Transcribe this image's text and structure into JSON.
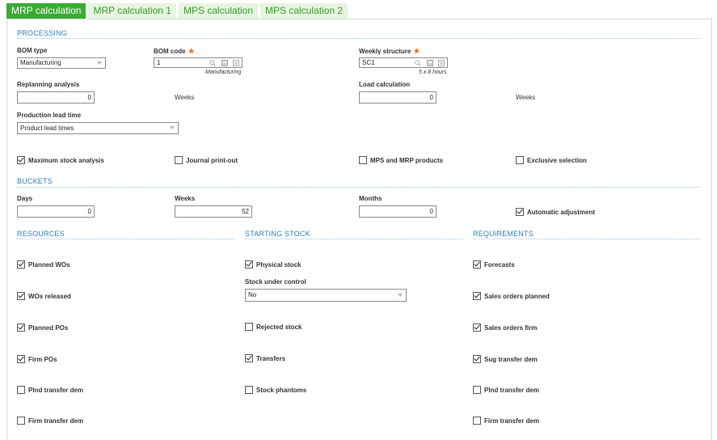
{
  "tabs": [
    "MRP calculation",
    "MRP calculation 1",
    "MPS calculation",
    "MPS calculation 2"
  ],
  "processing": {
    "title": "PROCESSING",
    "bom_type": {
      "label": "BOM type",
      "value": "Manufacturing"
    },
    "bom_code": {
      "label": "BOM code",
      "value": "1",
      "hint": "Manufacturing"
    },
    "weekly_structure": {
      "label": "Weekly structure",
      "value": "SC1",
      "hint": "5 x 8 hours"
    },
    "replanning": {
      "label": "Replanning analysis",
      "value": "0",
      "unit": "Weeks"
    },
    "load_calc": {
      "label": "Load calculation",
      "value": "0",
      "unit": "Weeks"
    },
    "prod_lead": {
      "label": "Production lead time",
      "value": "Product lead times"
    },
    "checks": [
      {
        "label": "Maximum stock analysis",
        "checked": true
      },
      {
        "label": "Journal print-out",
        "checked": false
      },
      {
        "label": "MPS and MRP products",
        "checked": false
      },
      {
        "label": "Exclusive selection",
        "checked": false
      }
    ]
  },
  "buckets": {
    "title": "BUCKETS",
    "days": {
      "label": "Days",
      "value": "0"
    },
    "weeks": {
      "label": "Weeks",
      "value": "52"
    },
    "months": {
      "label": "Months",
      "value": "0"
    },
    "auto": {
      "label": "Automatic adjustment",
      "checked": true
    }
  },
  "resources": {
    "title": "RESOURCES",
    "items": [
      {
        "label": "Planned WOs",
        "checked": true
      },
      {
        "label": "WOs released",
        "checked": true
      },
      {
        "label": "Planned POs",
        "checked": true
      },
      {
        "label": "Firm POs",
        "checked": true
      },
      {
        "label": "Plnd transfer dem",
        "checked": false
      },
      {
        "label": "Firm transfer dem",
        "checked": false
      }
    ]
  },
  "starting_stock": {
    "title": "STARTING STOCK",
    "physical": {
      "label": "Physical stock",
      "checked": true
    },
    "under_control": {
      "label": "Stock under control",
      "value": "No"
    },
    "rejected": {
      "label": "Rejected stock",
      "checked": false
    },
    "transfers": {
      "label": "Transfers",
      "checked": true
    },
    "phantoms": {
      "label": "Stock phantoms",
      "checked": false
    }
  },
  "requirements": {
    "title": "REQUIREMENTS",
    "items": [
      {
        "label": "Forecasts",
        "checked": true
      },
      {
        "label": "Sales orders planned",
        "checked": true
      },
      {
        "label": "Sales orders firm",
        "checked": true
      },
      {
        "label": "Sug transfer dem",
        "checked": true
      },
      {
        "label": "Plnd transfer dem",
        "checked": false
      },
      {
        "label": "Firm transfer dem",
        "checked": false
      }
    ]
  }
}
